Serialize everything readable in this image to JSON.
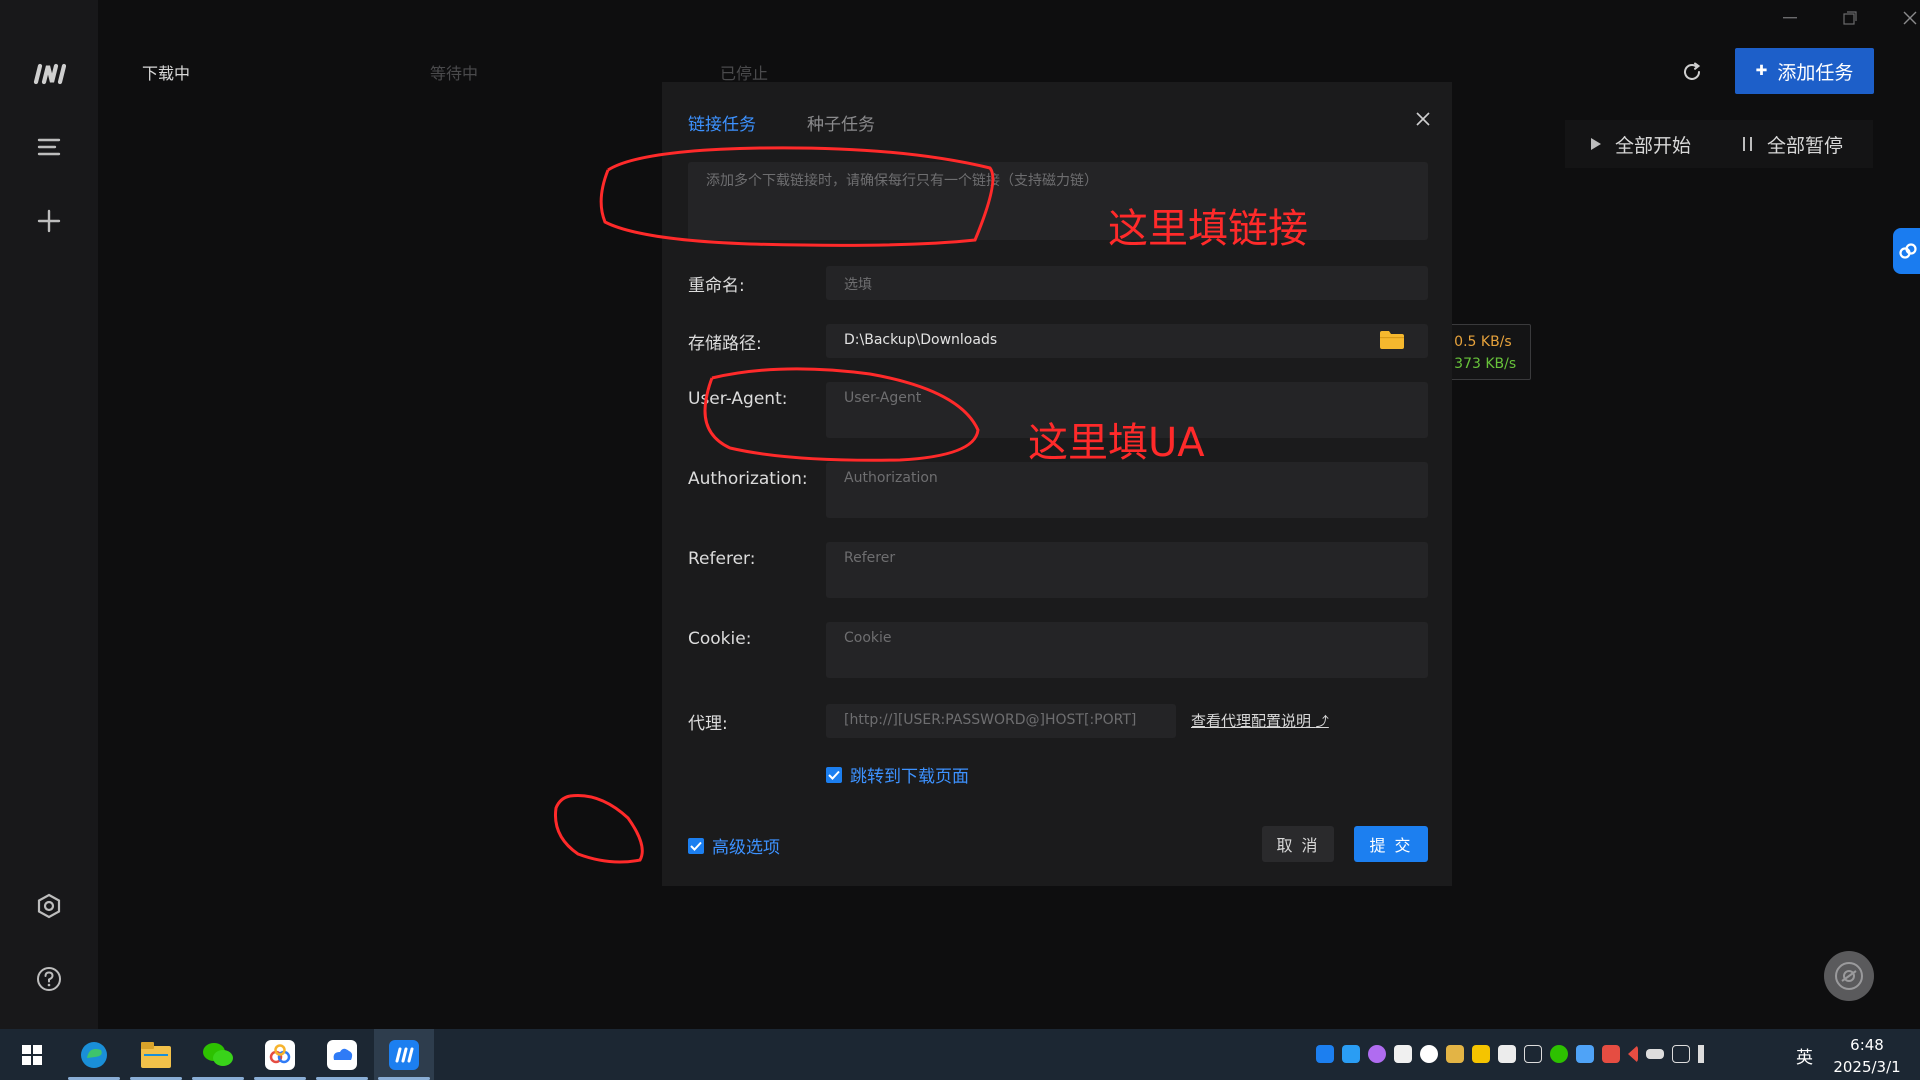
{
  "header": {
    "tabs": [
      "下载中",
      "等待中",
      "已停止"
    ],
    "add_task_label": "添加任务",
    "start_all_label": "全部开始",
    "pause_all_label": "全部暂停"
  },
  "speed": {
    "up": "↑ 0.5 KB/s",
    "down": "↓ 373 KB/s"
  },
  "dialog": {
    "tabs": [
      "链接任务",
      "种子任务"
    ],
    "links_placeholder": "添加多个下载链接时，请确保每行只有一个链接（支持磁力链）",
    "rename_label": "重命名:",
    "rename_placeholder": "选填",
    "path_label": "存储路径:",
    "path_value": "D:\\Backup\\Downloads",
    "ua_label": "User-Agent:",
    "ua_placeholder": "User-Agent",
    "auth_label": "Authorization:",
    "auth_placeholder": "Authorization",
    "referer_label": "Referer:",
    "referer_placeholder": "Referer",
    "cookie_label": "Cookie:",
    "cookie_placeholder": "Cookie",
    "proxy_label": "代理:",
    "proxy_placeholder": "[http://][USER:PASSWORD@]HOST[:PORT]",
    "proxy_help": "查看代理配置说明",
    "jump_label": "跳转到下载页面",
    "jump_checked": true,
    "advanced_label": "高级选项",
    "advanced_checked": true,
    "cancel_label": "取 消",
    "submit_label": "提 交"
  },
  "annotations": {
    "link_note": "这里填链接",
    "ua_note": "这里填UA"
  },
  "taskbar": {
    "ime": "英",
    "time": "6:48",
    "date": "2025/3/1"
  },
  "colors": {
    "accent": "#1c7ff0",
    "annotation": "#ff2a2a",
    "upload": "#e6a23c",
    "download": "#67c23a"
  }
}
